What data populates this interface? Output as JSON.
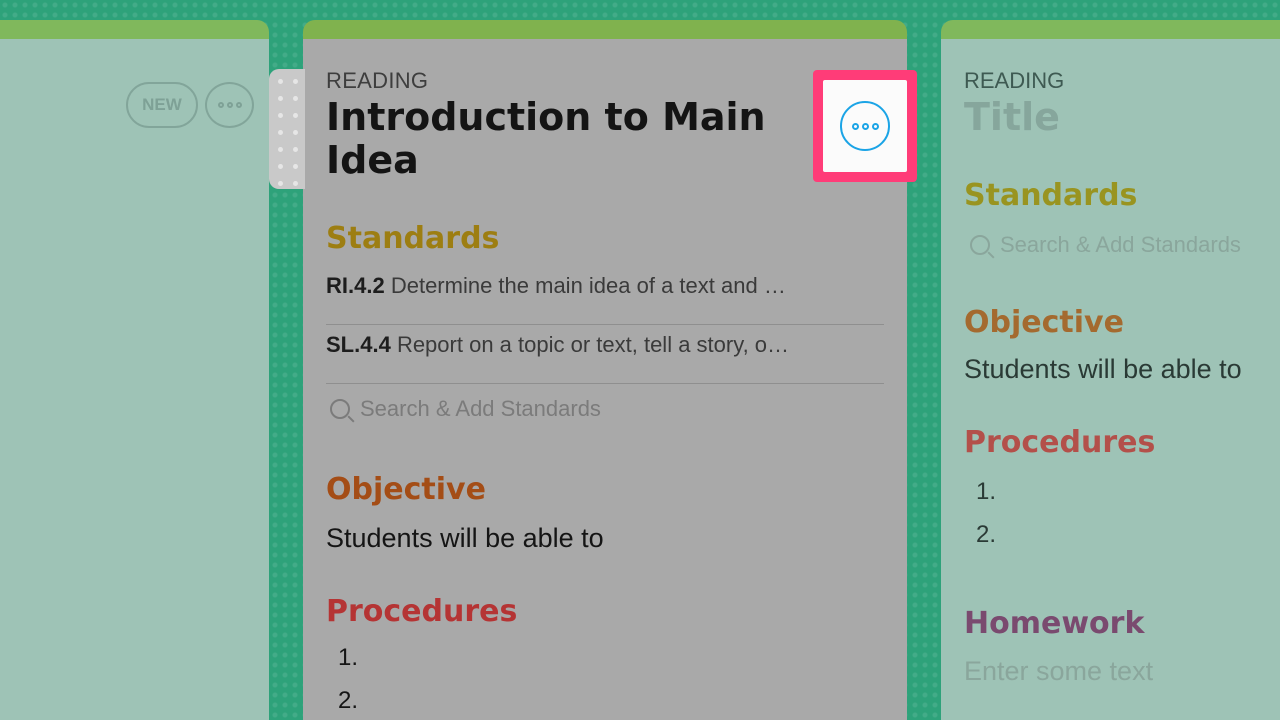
{
  "left_column": {
    "new_label": "NEW",
    "more_icon": "ellipsis-icon"
  },
  "lesson": {
    "subject": "READING",
    "title": "Introduction to Main Idea",
    "standards_heading": "Standards",
    "standards": [
      {
        "code": "RI.4.2",
        "text": "Determine the main idea of a text and …"
      },
      {
        "code": "SL.4.4",
        "text": "Report on a topic or text, tell a story, o…"
      }
    ],
    "search_placeholder": "Search & Add Standards",
    "objective_heading": "Objective",
    "objective_text": "Students will be able to",
    "procedures_heading": "Procedures",
    "procedures": [
      "1.",
      "2."
    ],
    "more_icon": "ellipsis-icon",
    "highlight_color": "#ff3c78"
  },
  "next_lesson": {
    "subject": "READING",
    "title": "Title",
    "standards_heading": "Standards",
    "search_placeholder": "Search & Add Standards",
    "objective_heading": "Objective",
    "objective_text": "Students will be able to",
    "procedures_heading": "Procedures",
    "procedures": [
      "1.",
      "2."
    ],
    "homework_heading": "Homework",
    "homework_placeholder": "Enter some text"
  }
}
